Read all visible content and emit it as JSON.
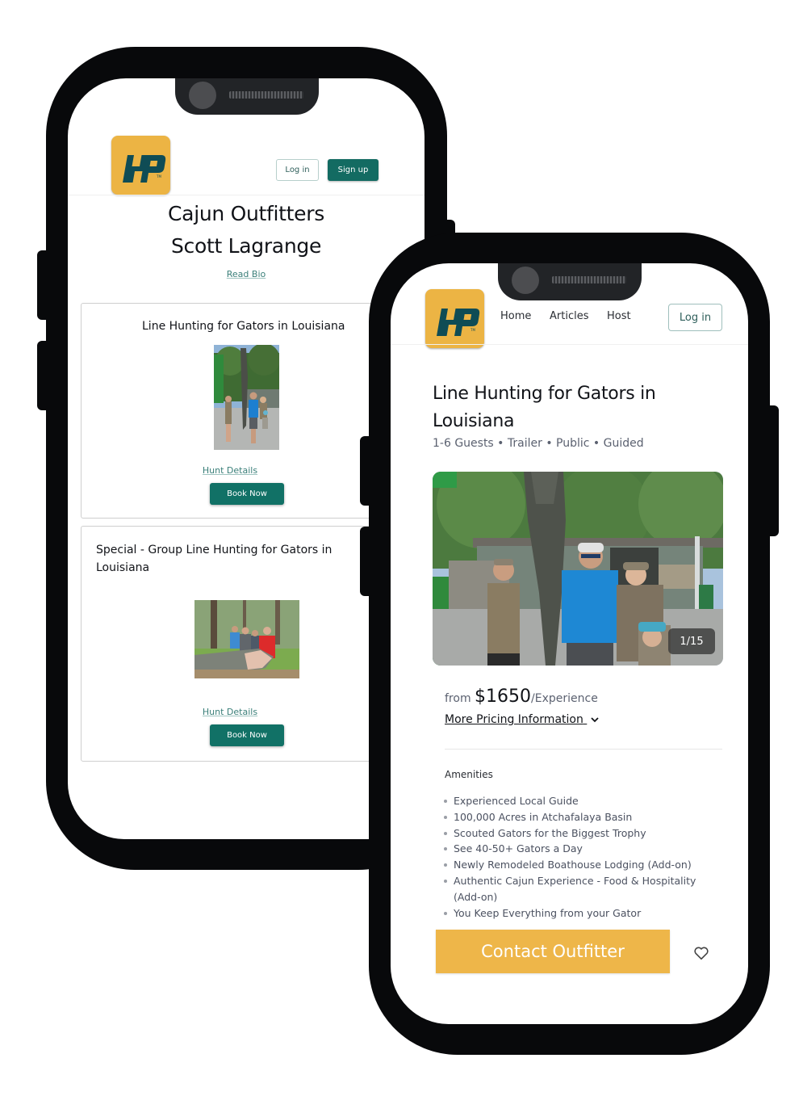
{
  "colors": {
    "brand_yellow": "#ecb444",
    "brand_teal": "#136b62",
    "logo_mark": "#0f4c55",
    "cta_yellow": "#eeb649",
    "phone_frame": "#08090b"
  },
  "left_phone": {
    "logo": {
      "icon": "hp-logo",
      "text": "HP",
      "trademark": "TM"
    },
    "header": {
      "login_label": "Log in",
      "signup_label": "Sign up"
    },
    "outfitter": {
      "name": "Cajun Outfitters",
      "guide": "Scott Lagrange",
      "bio_link": "Read Bio"
    },
    "hunts": [
      {
        "title": "Line Hunting for Gators in Louisiana",
        "photo": "family-with-hanging-alligator-photo",
        "details_link": "Hunt Details",
        "book_label": "Book Now"
      },
      {
        "title": "Special - Group Line Hunting for Gators in Louisiana",
        "photo": "group-with-alligator-photo",
        "details_link": "Hunt Details",
        "book_label": "Book Now"
      }
    ]
  },
  "right_phone": {
    "logo": {
      "icon": "hp-logo",
      "text": "HP",
      "trademark": "TM"
    },
    "nav": {
      "items": [
        "Home",
        "Articles",
        "Host"
      ],
      "login_label": "Log in"
    },
    "listing": {
      "title": "Line Hunting for Gators in Louisiana",
      "meta": "1-6 Guests • Trailer • Public • Guided",
      "gallery": {
        "photo": "family-with-hanging-alligator-photo",
        "counter": "1/15",
        "current": 1,
        "total": 15
      },
      "price": {
        "prefix": "from",
        "amount": "$1650",
        "unit": "/Experience"
      },
      "more_pricing_label": "More Pricing Information",
      "amenities_title": "Amenities",
      "amenities": [
        "Experienced Local Guide",
        "100,000 Acres in Atchafalaya Basin",
        "Scouted Gators for the Biggest Trophy",
        "See 40-50+ Gators a Day",
        "Newly Remodeled Boathouse Lodging (Add-on)",
        "Authentic Cajun Experience - Food & Hospitality (Add-on)",
        "You Keep Everything from your Gator"
      ],
      "contact_label": "Contact Outfitter",
      "favorite_icon": "heart-icon"
    }
  }
}
